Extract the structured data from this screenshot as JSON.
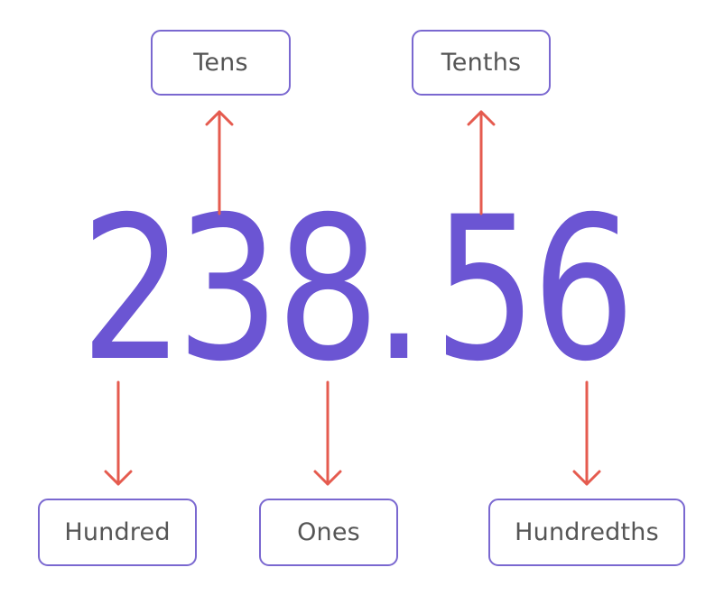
{
  "number": {
    "digits": [
      "2",
      "3",
      "8",
      ".",
      "5",
      "6"
    ]
  },
  "labels": {
    "tens": "Tens",
    "tenths": "Tenths",
    "hundred": "Hundred",
    "ones": "Ones",
    "hundredths": "Hundredths"
  },
  "colors": {
    "digit": "#6b55d3",
    "arrow": "#e55b4f",
    "box_border": "#7a68d0",
    "label_text": "#555555"
  },
  "icons": {
    "arrow_up": "arrow-up-icon",
    "arrow_down": "arrow-down-icon"
  }
}
